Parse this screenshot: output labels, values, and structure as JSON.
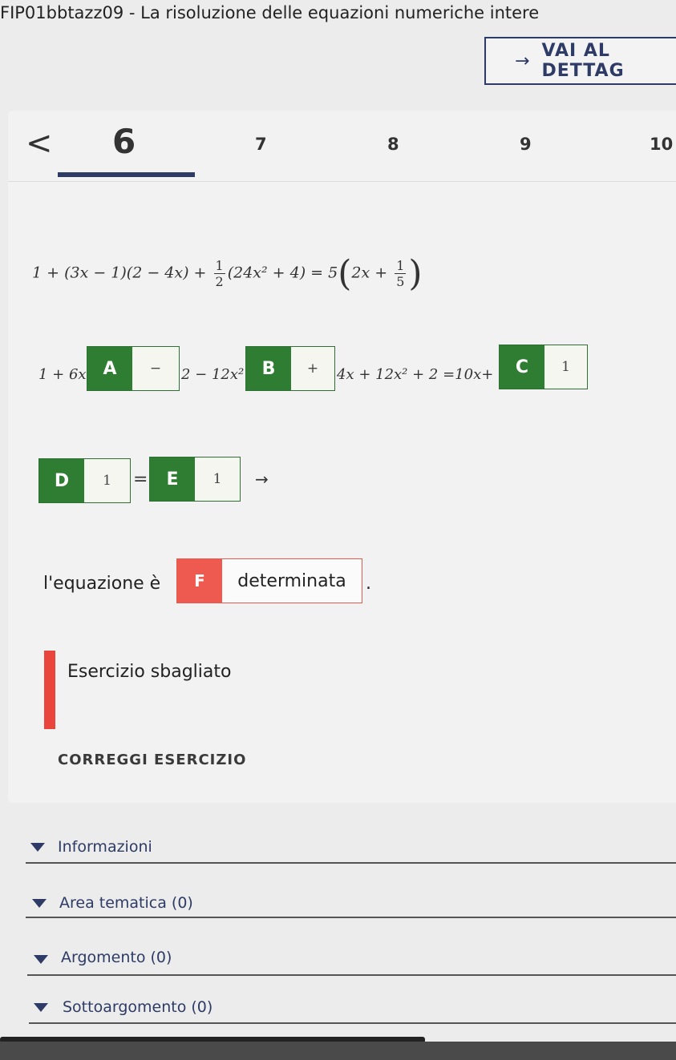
{
  "page": {
    "title": "FIP01bbtazz09 - La risoluzione delle equazioni numeriche intere"
  },
  "detail_button": {
    "label": "VAI AL DETTAG"
  },
  "pager": {
    "prev_icon": "chevron-left-icon",
    "pages": [
      "6",
      "7",
      "8",
      "9",
      "10"
    ],
    "active": "6"
  },
  "exercise": {
    "equation": {
      "p1": "1 + (3x − 1)(2 − 4x) + ",
      "f1_num": "1",
      "f1_den": "2",
      "p2": "(24x² + 4) = 5",
      "p3": "2x + ",
      "f2_num": "1",
      "f2_den": "5"
    },
    "row1": {
      "t1": "1 + 6x",
      "slotA": {
        "tag": "A",
        "value": "−"
      },
      "t2": "2 − 12x²",
      "slotB": {
        "tag": "B",
        "value": "+"
      },
      "t3": "4x + 12x² + 2 =10x+",
      "slotC": {
        "tag": "C",
        "value": "1"
      }
    },
    "row2": {
      "slotD": {
        "tag": "D",
        "value": "1"
      },
      "eq": "=",
      "slotE": {
        "tag": "E",
        "value": "1"
      },
      "arrow": "→"
    },
    "row3": {
      "text": "l'equazione è",
      "slotF": {
        "tag": "F",
        "value": "determinata"
      },
      "period": "."
    },
    "feedback": "Esercizio sbagliato",
    "correct_button": "CORREGGI ESERCIZIO"
  },
  "accordions": [
    "Informazioni",
    "Area tematica (0)",
    "Argomento (0)",
    "Sottoargomento (0)"
  ],
  "colors": {
    "accent": "#2d3b66",
    "slot_green": "#2e7d32",
    "error_red": "#e9453c",
    "slot_F": "#ee5a4f"
  }
}
